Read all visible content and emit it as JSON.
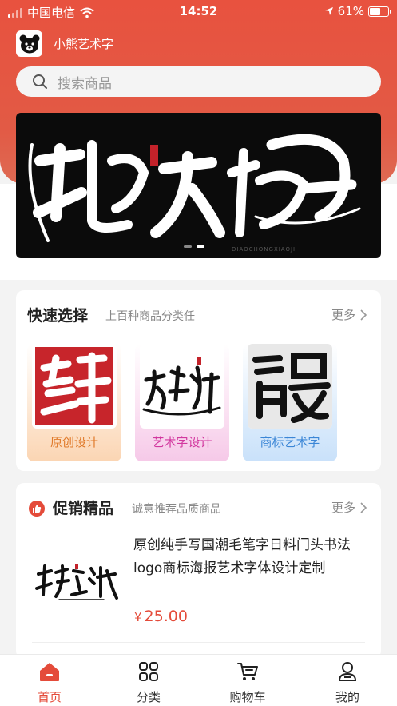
{
  "status_bar": {
    "carrier": "中国电信",
    "time": "14:52",
    "battery": "61%",
    "battery_level": 0.61
  },
  "app": {
    "name": "小熊艺术字"
  },
  "search": {
    "placeholder": "搜索商品"
  },
  "banner": {
    "headline": "地球大炮",
    "small_text": "DIAOCHONGXIAOJI",
    "slides": 2,
    "active_slide": 2
  },
  "quick_select": {
    "title": "快速选择",
    "subtitle": "上百种商品分类任",
    "more_label": "更多",
    "categories": [
      {
        "label": "原创设计",
        "art": "鲜",
        "color": "#e07a2a"
      },
      {
        "label": "艺术字设计",
        "art": "东方",
        "color": "#d2389f"
      },
      {
        "label": "商标艺术字",
        "art": "留曼",
        "color": "#3b86d6"
      }
    ]
  },
  "promo": {
    "title": "促销精品",
    "subtitle": "诚意推荐品质商品",
    "more_label": "更多",
    "product": {
      "name": "原创纯手写国潮毛笔字日料门头书法logo商标海报艺术字体设计定制",
      "currency": "¥",
      "price": "25.00",
      "image_text": "极道江湖"
    }
  },
  "tabbar": {
    "items": [
      {
        "label": "首页",
        "icon": "home-icon",
        "active": true
      },
      {
        "label": "分类",
        "icon": "grid-icon",
        "active": false
      },
      {
        "label": "购物车",
        "icon": "cart-icon",
        "active": false
      },
      {
        "label": "我的",
        "icon": "user-icon",
        "active": false
      }
    ]
  },
  "colors": {
    "brand_red": "#e44b3a",
    "header_red": "#e8523f"
  }
}
